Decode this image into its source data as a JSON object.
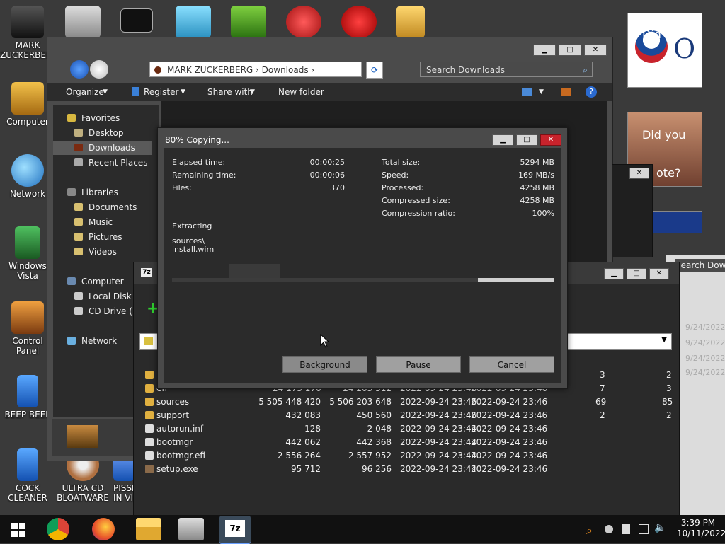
{
  "desktop": {
    "icons": [
      {
        "label": "MARK ZUCKERBERG",
        "color": "#2a2a2a"
      },
      {
        "label": "Computer",
        "color": "#d89a2a"
      },
      {
        "label": "Network",
        "color": "#3a9ad8"
      },
      {
        "label": "Windows Vista",
        "color": "#2d8a3a"
      },
      {
        "label": "Control Panel",
        "color": "#c86a2a"
      },
      {
        "label": "BEEP BEEP",
        "color": "#1f6fd0"
      },
      {
        "label": "COCK CLEANER",
        "color": "#1f6fd0"
      },
      {
        "label": "ULTRA CD BLOATWARE",
        "color": "#8a5a2a"
      },
      {
        "label": "PISSED IN VI",
        "color": "#3a6ad8"
      }
    ]
  },
  "explorer": {
    "breadcrumb": [
      "MARK ZUCKERBERG",
      "Downloads"
    ],
    "search_placeholder": "Search Downloads",
    "toolbar": {
      "organize": "Organize",
      "register": "Register",
      "share": "Share with",
      "new_folder": "New folder"
    },
    "nav": {
      "favorites": "Favorites",
      "desktop": "Desktop",
      "downloads": "Downloads",
      "recent": "Recent Places",
      "libraries": "Libraries",
      "documents": "Documents",
      "music": "Music",
      "pictures": "Pictures",
      "videos": "Videos",
      "computer": "Computer",
      "local_disk": "Local Disk (C",
      "cd_drive": "CD Drive (E:",
      "network": "Network"
    }
  },
  "dialog": {
    "title": "80% Copying...",
    "elapsed_label": "Elapsed time:",
    "elapsed": "00:00:25",
    "remaining_label": "Remaining time:",
    "remaining": "00:00:06",
    "files_label": "Files:",
    "files": "370",
    "total_label": "Total size:",
    "total": "5294 MB",
    "speed_label": "Speed:",
    "speed": "169 MB/s",
    "processed_label": "Processed:",
    "processed": "4258 MB",
    "compressed_label": "Compressed size:",
    "compressed": "4258 MB",
    "ratio_label": "Compression ratio:",
    "ratio": "100%",
    "action": "Extracting",
    "path1": "sources\\",
    "path2": "install.wim",
    "progress_fraction": 0.8,
    "buttons": {
      "background": "Background",
      "pause": "Pause",
      "cancel": "Cancel"
    }
  },
  "zip_rows": [
    {
      "name": "efi",
      "size": "24 175 170",
      "packed": "24 203 512",
      "modified": "2022-09-24 23:46",
      "created": "2022-09-24 23:46",
      "folders": "7",
      "files": "3"
    },
    {
      "name": "sources",
      "size": "5 505 448 420",
      "packed": "5 506 203 648",
      "modified": "2022-09-24 23:46",
      "created": "2022-09-24 23:46",
      "folders": "69",
      "files": "85"
    },
    {
      "name": "support",
      "size": "432 083",
      "packed": "450 560",
      "modified": "2022-09-24 23:46",
      "created": "2022-09-24 23:46",
      "folders": "2",
      "files": "2"
    },
    {
      "name": "autorun.inf",
      "size": "128",
      "packed": "2 048",
      "modified": "2022-09-24 23:44",
      "created": "2022-09-24 23:46",
      "folders": "",
      "files": ""
    },
    {
      "name": "bootmgr",
      "size": "442 062",
      "packed": "442 368",
      "modified": "2022-09-24 23:44",
      "created": "2022-09-24 23:46",
      "folders": "",
      "files": ""
    },
    {
      "name": "bootmgr.efi",
      "size": "2 556 264",
      "packed": "2 557 952",
      "modified": "2022-09-24 23:44",
      "created": "2022-09-24 23:46",
      "folders": "",
      "files": ""
    },
    {
      "name": "setup.exe",
      "size": "95 712",
      "packed": "96 256",
      "modified": "2022-09-24 23:44",
      "created": "2022-09-24 23:46",
      "folders": "",
      "files": ""
    }
  ],
  "side_window": {
    "search": "Search Down",
    "dates": [
      "9/24/2022",
      "9/24/2022",
      "9/24/2022",
      "9/24/2022"
    ]
  },
  "taskbar": {
    "time": "3:39 PM",
    "date": "10/11/2022"
  },
  "thumbs": {
    "t1": "Did yo",
    "t2a": "Did you",
    "t2b": "ote?"
  }
}
